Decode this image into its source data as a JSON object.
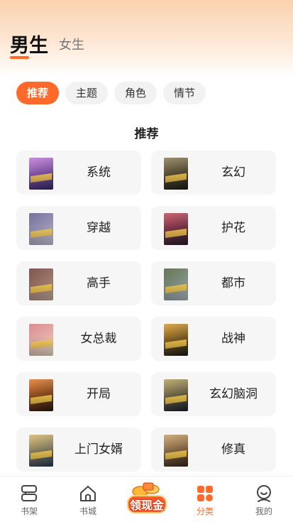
{
  "header": {
    "tabs": [
      {
        "label": "男生",
        "active": true
      },
      {
        "label": "女生",
        "active": false
      }
    ]
  },
  "filters": {
    "chips": [
      {
        "label": "推荐",
        "active": true
      },
      {
        "label": "主题",
        "active": false
      },
      {
        "label": "角色",
        "active": false
      },
      {
        "label": "情节",
        "active": false
      }
    ]
  },
  "section": {
    "title": "推荐"
  },
  "categories": [
    {
      "label": "系统",
      "cover_colors": [
        "#3a2c6e",
        "#c07bd6"
      ]
    },
    {
      "label": "玄幻",
      "cover_colors": [
        "#1e1d1a",
        "#8d7c55"
      ]
    },
    {
      "label": "穿越",
      "cover_colors": [
        "#d9d6e8",
        "#5f5a8a"
      ]
    },
    {
      "label": "护花",
      "cover_colors": [
        "#2a1f33",
        "#c24a5a"
      ]
    },
    {
      "label": "高手",
      "cover_colors": [
        "#d4b8a8",
        "#6a3b33"
      ]
    },
    {
      "label": "都市",
      "cover_colors": [
        "#b9c6cf",
        "#4c5f3d"
      ]
    },
    {
      "label": "女总裁",
      "cover_colors": [
        "#f4ecd6",
        "#d77a7f"
      ]
    },
    {
      "label": "战神",
      "cover_colors": [
        "#1b1b1b",
        "#d69a2c"
      ]
    },
    {
      "label": "开局",
      "cover_colors": [
        "#2b1b14",
        "#e07a2c"
      ]
    },
    {
      "label": "玄幻脑洞",
      "cover_colors": [
        "#1c2333",
        "#b5a05c"
      ]
    },
    {
      "label": "上门女婿",
      "cover_colors": [
        "#2a3f5a",
        "#d8b86a"
      ]
    },
    {
      "label": "修真",
      "cover_colors": [
        "#3d2a1c",
        "#c8a26a"
      ]
    }
  ],
  "bottom_nav": {
    "items": [
      {
        "label": "书架",
        "icon": "bookshelf-icon",
        "active": false
      },
      {
        "label": "书城",
        "icon": "home-icon",
        "active": false
      },
      {
        "label": "分类",
        "icon": "category-grid-icon",
        "active": true
      },
      {
        "label": "我的",
        "icon": "profile-icon",
        "active": false
      }
    ],
    "promo_badge": {
      "label": "领现金"
    }
  },
  "colors": {
    "accent": "#ff6a2a",
    "chip_bg": "#f2f2f2",
    "card_bg": "#f6f6f6",
    "header_gradient_top": "#fbd2ae"
  }
}
